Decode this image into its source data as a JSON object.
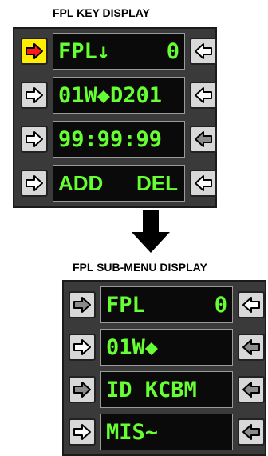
{
  "key_display": {
    "title": "FPL KEY DISPLAY",
    "rows": [
      {
        "left": "FPL↓",
        "right": "0",
        "left_button": {
          "icon": "right-arrow-icon",
          "active": true,
          "fill": "#ff0000"
        },
        "right_button": {
          "icon": "left-arrow-icon",
          "enabled": true
        }
      },
      {
        "left": "01W◆D201",
        "right": "",
        "left_button": {
          "icon": "right-arrow-icon",
          "active": false
        },
        "right_button": {
          "icon": "left-arrow-icon",
          "enabled": true
        }
      },
      {
        "left": "99:99:99",
        "right": "",
        "left_button": {
          "icon": "right-arrow-icon",
          "active": false
        },
        "right_button": {
          "icon": "left-arrow-icon",
          "enabled": false
        }
      },
      {
        "left": "ADD",
        "right": "DEL",
        "left_button": {
          "icon": "right-arrow-icon",
          "active": false
        },
        "right_button": {
          "icon": "left-arrow-icon",
          "enabled": true
        }
      }
    ]
  },
  "transition_icon": "down-arrow-icon",
  "sub_menu_display": {
    "title": "FPL SUB-MENU DISPLAY",
    "rows": [
      {
        "left": "FPL",
        "right": "0",
        "left_button": {
          "icon": "right-arrow-icon",
          "enabled": false
        },
        "right_button": {
          "icon": "left-arrow-icon",
          "enabled": true
        }
      },
      {
        "left": "01W◆",
        "right": "",
        "left_button": {
          "icon": "right-arrow-icon",
          "enabled": true
        },
        "right_button": {
          "icon": "left-arrow-icon",
          "enabled": false
        }
      },
      {
        "left": "ID KCBM",
        "right": "",
        "left_button": {
          "icon": "right-arrow-icon",
          "enabled": false
        },
        "right_button": {
          "icon": "left-arrow-icon",
          "enabled": false
        }
      },
      {
        "left": "MIS~",
        "right": "",
        "left_button": {
          "icon": "right-arrow-icon",
          "enabled": true
        },
        "right_button": {
          "icon": "left-arrow-icon",
          "enabled": false
        }
      }
    ]
  },
  "colors": {
    "screen_text": "#66ff33",
    "screen_bg": "#0a0a0a",
    "active_button": "#ffee00",
    "panel": "#3a3a3a"
  }
}
